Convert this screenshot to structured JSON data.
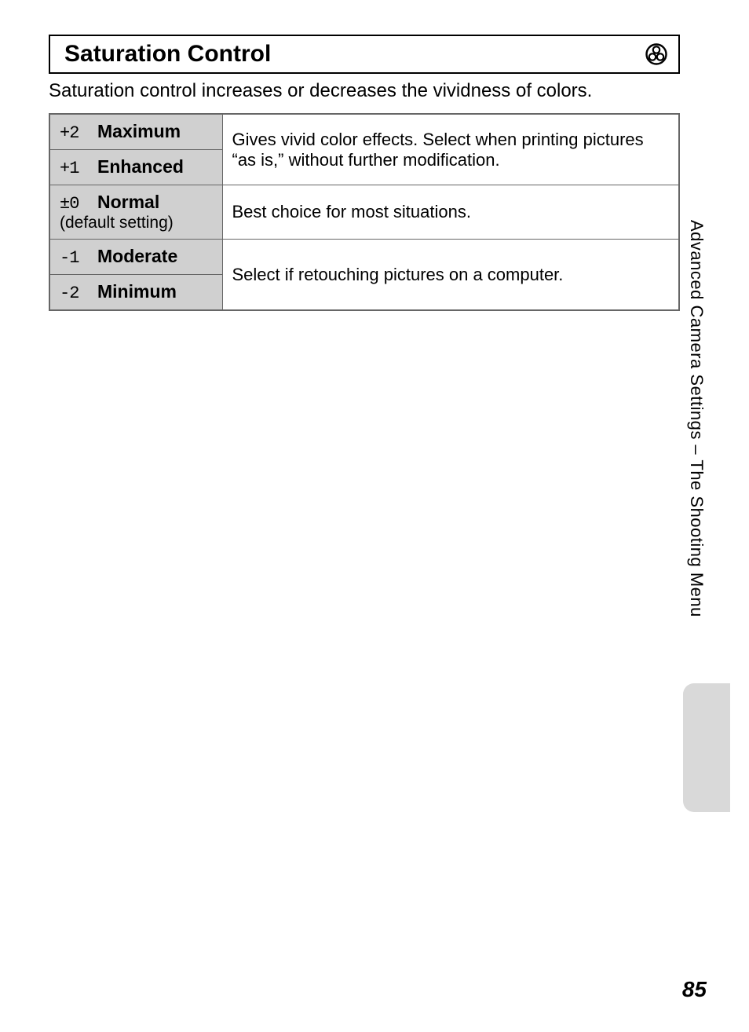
{
  "section": {
    "title": "Saturation Control",
    "icon_name": "saturation-icon"
  },
  "intro": "Saturation control increases or decreases the vividness of colors.",
  "table": {
    "rows": [
      {
        "glyph": "+2",
        "name": "Maximum",
        "sub": ""
      },
      {
        "glyph": "+1",
        "name": "Enhanced",
        "sub": ""
      },
      {
        "glyph": "±0",
        "name": "Normal",
        "sub": "(default setting)"
      },
      {
        "glyph": "-1",
        "name": "Moderate",
        "sub": ""
      },
      {
        "glyph": "-2",
        "name": "Minimum",
        "sub": ""
      }
    ],
    "desc": {
      "vivid": "Gives vivid color effects. Select when printing pictures “as is,” without further modification.",
      "normal": "Best choice for most situations.",
      "retouch": "Select if retouching pictures on a computer."
    }
  },
  "side_text": "Advanced Camera Settings – The Shooting Menu",
  "page_number": "85"
}
